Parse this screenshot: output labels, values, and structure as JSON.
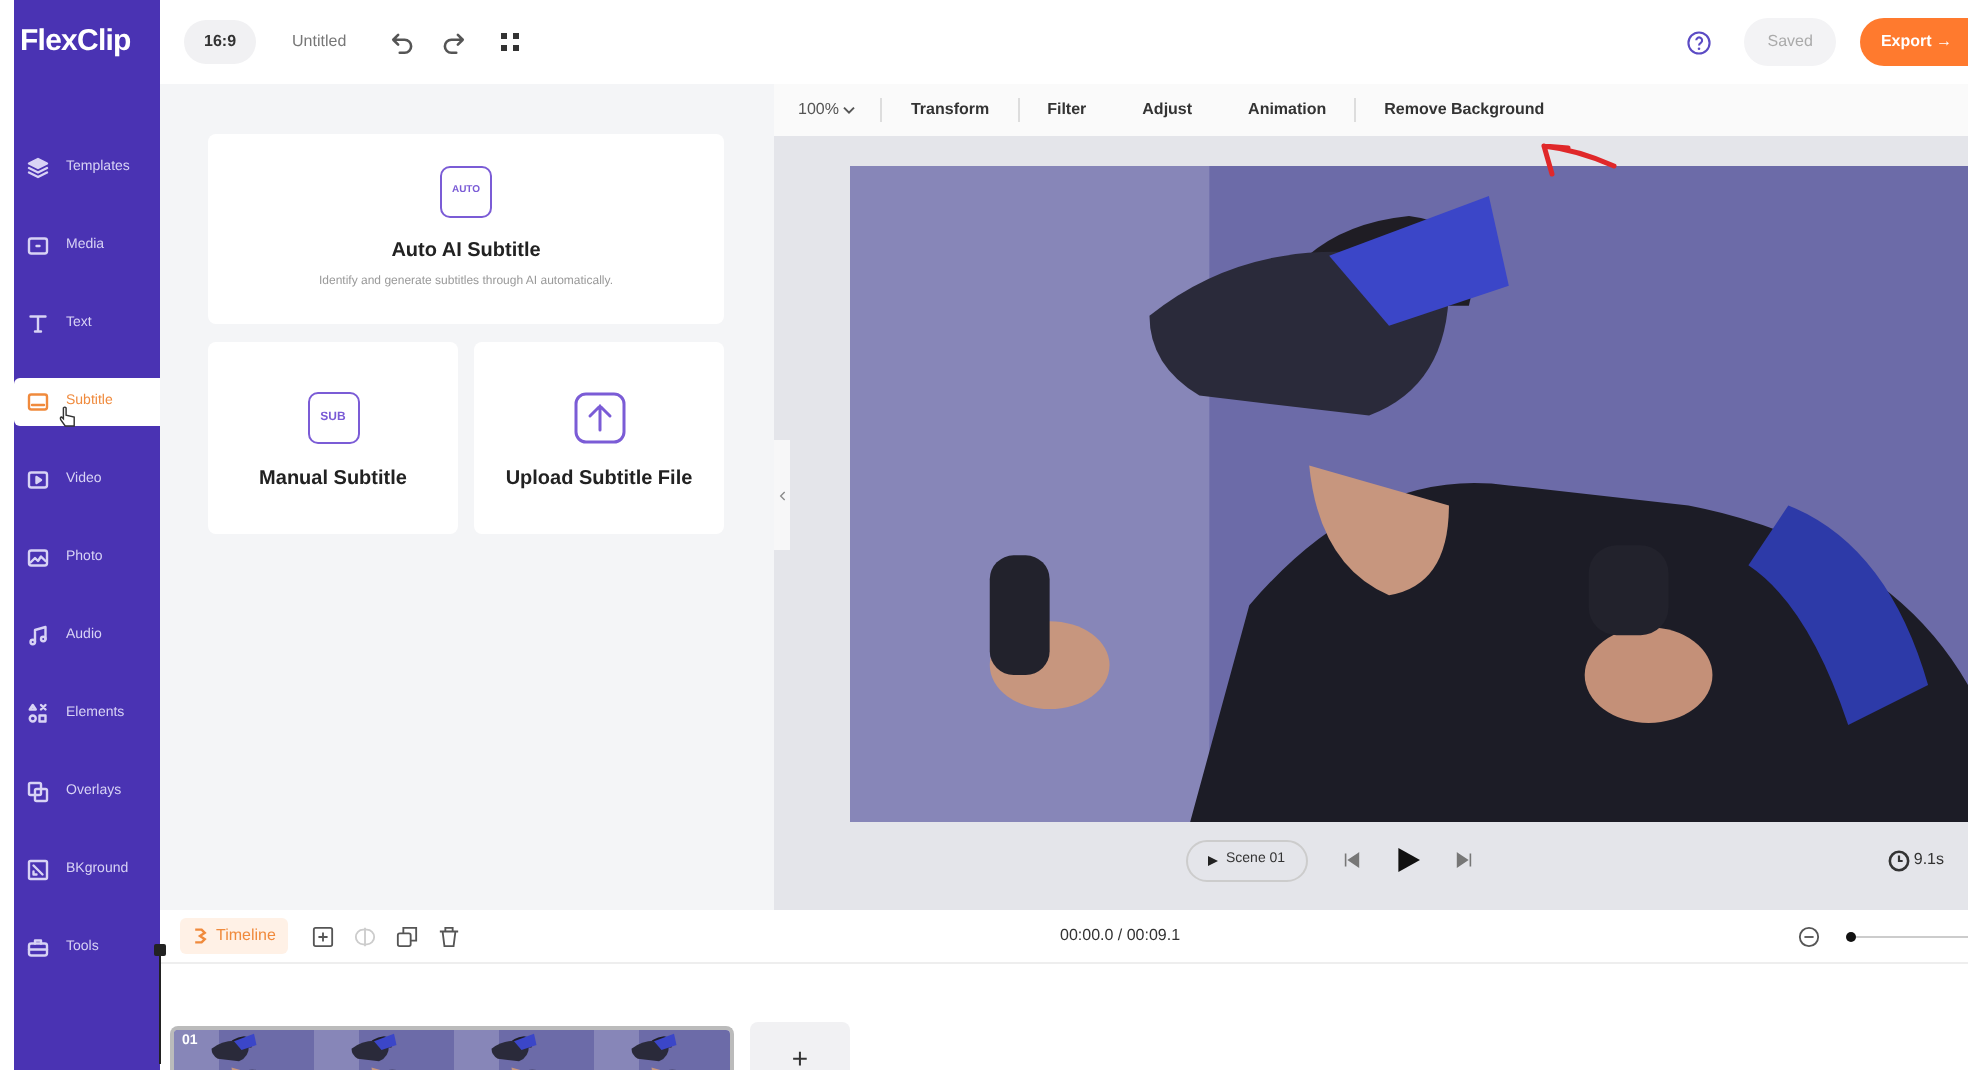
{
  "logo": {
    "text": "FlexClip"
  },
  "header": {
    "aspect_ratio": "16:9",
    "project_title": "Untitled",
    "saved": "Saved",
    "export": "Export →"
  },
  "sidebar": {
    "items": [
      {
        "label": "Templates",
        "selected": false
      },
      {
        "label": "Media",
        "selected": false
      },
      {
        "label": "Text",
        "selected": false
      },
      {
        "label": "Subtitle",
        "selected": true
      },
      {
        "label": "Video",
        "selected": false
      },
      {
        "label": "Photo",
        "selected": false
      },
      {
        "label": "Audio",
        "selected": false
      },
      {
        "label": "Elements",
        "selected": false
      },
      {
        "label": "Overlays",
        "selected": false
      },
      {
        "label": "BKground",
        "selected": false
      },
      {
        "label": "Tools",
        "selected": false
      }
    ]
  },
  "subtitle_panel": {
    "auto": {
      "badge": "AUTO",
      "title": "Auto AI Subtitle",
      "description": "Identify and generate subtitles through AI automatically."
    },
    "manual": {
      "badge": "SUB",
      "title": "Manual Subtitle"
    },
    "upload": {
      "title": "Upload Subtitle File"
    }
  },
  "toolbar": {
    "zoom": "100%",
    "items": [
      "Transform",
      "Filter",
      "Adjust",
      "Animation",
      "Remove Background"
    ]
  },
  "player": {
    "scene": "Scene 01",
    "duration": "9.1s"
  },
  "timeline": {
    "label": "Timeline",
    "time": "00:00.0 / 00:09.1",
    "zoom_slider": {
      "level": 0.02
    },
    "clip_number": "01",
    "add": "+"
  }
}
